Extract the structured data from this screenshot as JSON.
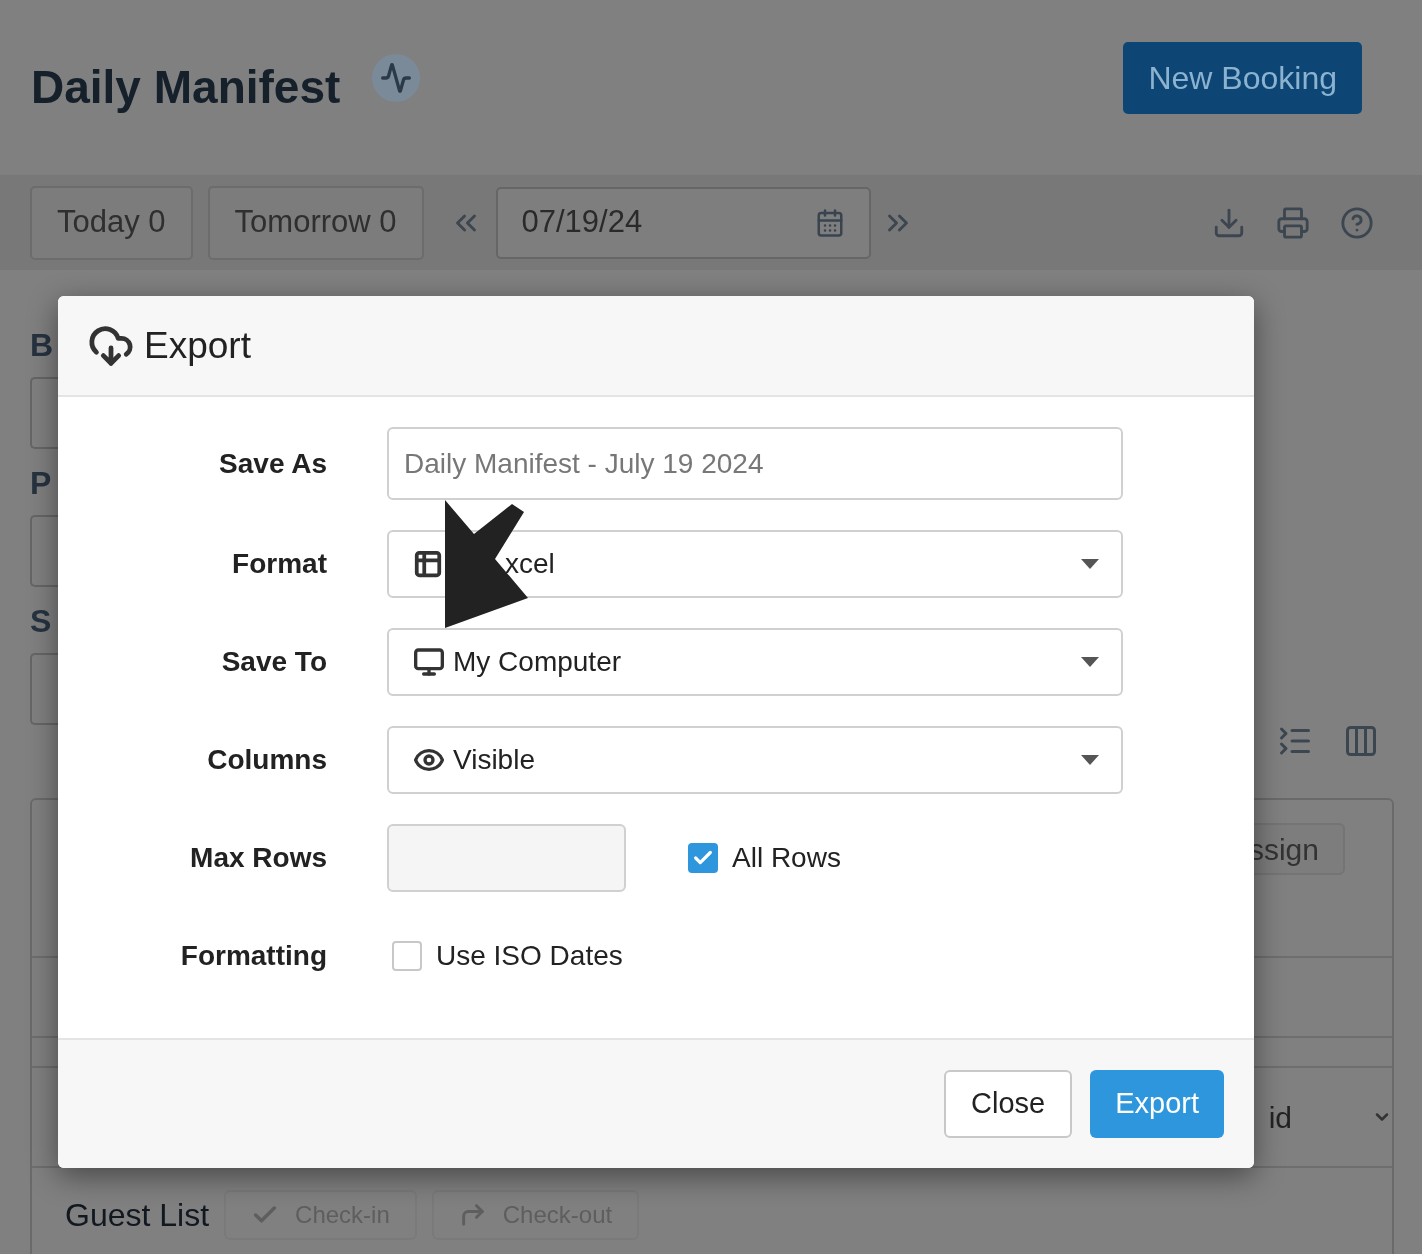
{
  "header": {
    "title": "Daily Manifest",
    "new_booking": "New Booking"
  },
  "toolbar": {
    "tabs": [
      {
        "label": "Today 0"
      },
      {
        "label": "Tomorrow 0"
      }
    ],
    "date": "07/19/24"
  },
  "background": {
    "section_labels": [
      "B",
      "P",
      "S"
    ],
    "assign_button": "ssign",
    "select_value": "id",
    "guest_list": {
      "title": "Guest List",
      "actions": [
        {
          "label": "Check-in",
          "disabled": true
        },
        {
          "label": "Check-out",
          "disabled": true
        }
      ]
    }
  },
  "dialog": {
    "title": "Export",
    "fields": [
      {
        "kind": "text",
        "label": "Save As",
        "placeholder": "Daily Manifest - July 19 2024"
      },
      {
        "kind": "select",
        "label": "Format",
        "value": "xcel"
      },
      {
        "kind": "select",
        "label": "Save To",
        "value": "My Computer"
      },
      {
        "kind": "select",
        "label": "Columns",
        "value": "Visible"
      },
      {
        "kind": "number_check",
        "label": "Max Rows",
        "checkbox": {
          "label": "All Rows",
          "checked": true
        }
      },
      {
        "kind": "check",
        "label": "Formatting",
        "checkbox": {
          "label": "Use ISO Dates",
          "checked": false
        }
      }
    ],
    "buttons": [
      {
        "kind": "secondary",
        "label": "Close"
      },
      {
        "kind": "primary",
        "label": "Export"
      }
    ]
  }
}
